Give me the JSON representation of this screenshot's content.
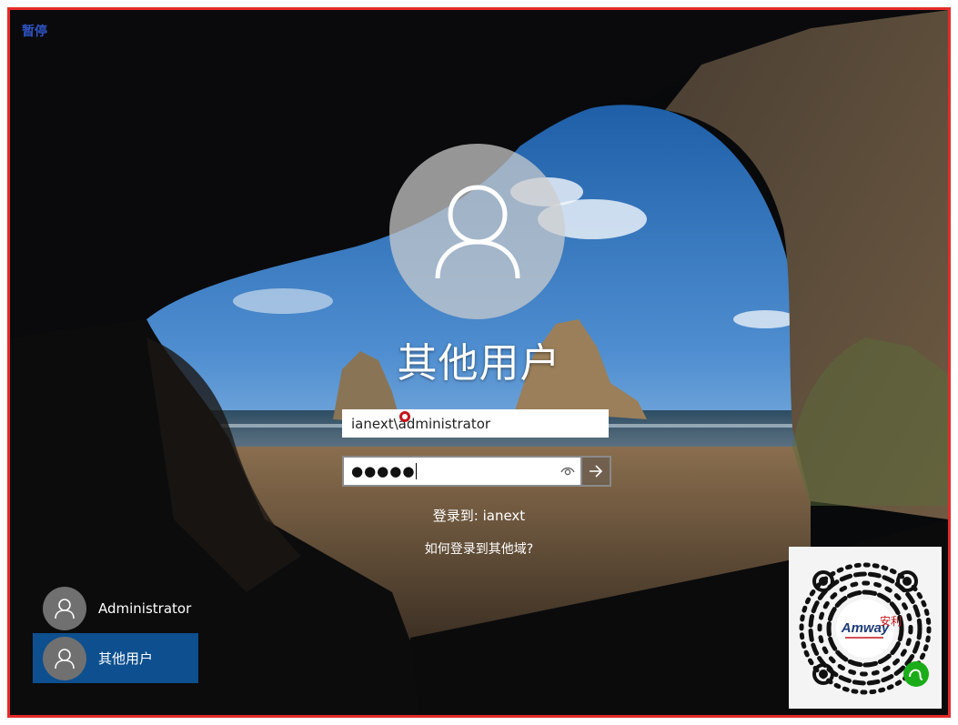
{
  "overlay": {
    "pause_label": "暂停"
  },
  "login": {
    "heading": "其他用户",
    "username_value": "ianext\\administrator",
    "password_mask": "●●●●●",
    "signin_to": "登录到: ianext",
    "other_domain_link": "如何登录到其他域?"
  },
  "users": [
    {
      "name": "Administrator",
      "selected": false
    },
    {
      "name": "其他用户",
      "selected": true
    }
  ],
  "qr": {
    "brand_text": "Amway",
    "brand_cn": "安利"
  },
  "colors": {
    "frame_border": "#e52a2a",
    "selected_user_bg": "#0d4f8f",
    "pause_text": "#2e55c8"
  }
}
